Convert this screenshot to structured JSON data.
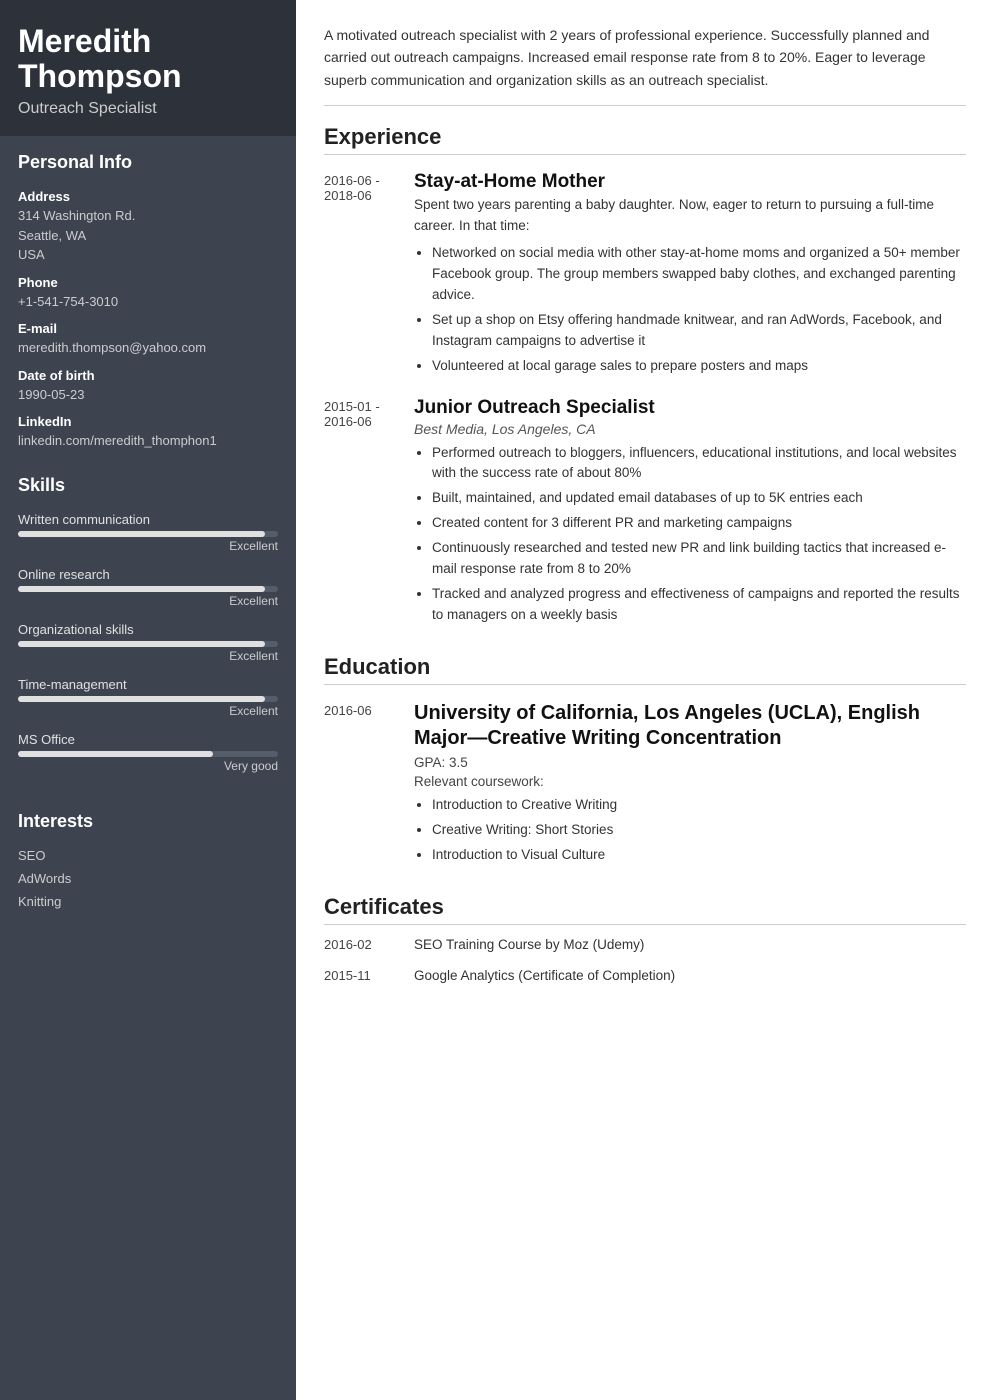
{
  "sidebar": {
    "name_line1": "Meredith",
    "name_line2": "Thompson",
    "job_title": "Outreach Specialist",
    "sections": {
      "personal_info": {
        "title": "Personal Info",
        "fields": [
          {
            "label": "Address",
            "value": "314 Washington Rd.\nSeattle, WA\nUSA"
          },
          {
            "label": "Phone",
            "value": "+1-541-754-3010"
          },
          {
            "label": "E-mail",
            "value": "meredith.thompson@yahoo.com"
          },
          {
            "label": "Date of birth",
            "value": "1990-05-23"
          },
          {
            "label": "LinkedIn",
            "value": "linkedin.com/meredith_thomphon1"
          }
        ]
      },
      "skills": {
        "title": "Skills",
        "items": [
          {
            "name": "Written communication",
            "level": "Excellent",
            "pct": 95
          },
          {
            "name": "Online research",
            "level": "Excellent",
            "pct": 95
          },
          {
            "name": "Organizational skills",
            "level": "Excellent",
            "pct": 95
          },
          {
            "name": "Time-management",
            "level": "Excellent",
            "pct": 95
          },
          {
            "name": "MS Office",
            "level": "Very good",
            "pct": 75
          }
        ]
      },
      "interests": {
        "title": "Interests",
        "items": [
          "SEO",
          "AdWords",
          "Knitting"
        ]
      }
    }
  },
  "main": {
    "summary": "A motivated outreach specialist with 2 years of professional experience. Successfully planned and carried out outreach campaigns. Increased email response rate from 8 to 20%. Eager to leverage superb communication and organization skills as an outreach specialist.",
    "experience": {
      "title": "Experience",
      "entries": [
        {
          "date": "2016-06 -\n2018-06",
          "job_title": "Stay-at-Home Mother",
          "company": "",
          "desc": "Spent two years parenting a baby daughter. Now, eager to return to pursuing a full-time career. In that time:",
          "bullets": [
            "Networked on social media with other stay-at-home moms and organized a 50+ member Facebook group. The group members swapped baby clothes, and exchanged parenting advice.",
            "Set up a shop on Etsy offering handmade knitwear, and ran AdWords, Facebook, and Instagram campaigns to advertise it",
            "Volunteered at local garage sales to prepare posters and maps"
          ]
        },
        {
          "date": "2015-01 -\n2016-06",
          "job_title": "Junior Outreach Specialist",
          "company": "Best Media, Los Angeles, CA",
          "desc": "",
          "bullets": [
            "Performed outreach to bloggers, influencers, educational institutions, and local websites with the success rate of about 80%",
            "Built, maintained, and updated email databases of up to 5K entries each",
            "Created content for 3 different PR and marketing campaigns",
            "Continuously researched and tested new PR and link building tactics that increased e-mail response rate from 8 to 20%",
            "Tracked and analyzed progress and effectiveness of campaigns and reported the results to managers on a weekly basis"
          ]
        }
      ]
    },
    "education": {
      "title": "Education",
      "entries": [
        {
          "date": "2016-06",
          "title": "University of California, Los Angeles (UCLA), English Major—Creative Writing Concentration",
          "gpa": "GPA: 3.5",
          "coursework_label": "Relevant coursework:",
          "coursework": [
            "Introduction to Creative Writing",
            "Creative Writing: Short Stories",
            "Introduction to Visual Culture"
          ]
        }
      ]
    },
    "certificates": {
      "title": "Certificates",
      "entries": [
        {
          "date": "2016-02",
          "name": "SEO Training Course by Moz (Udemy)"
        },
        {
          "date": "2015-11",
          "name": "Google Analytics (Certificate of Completion)"
        }
      ]
    }
  }
}
